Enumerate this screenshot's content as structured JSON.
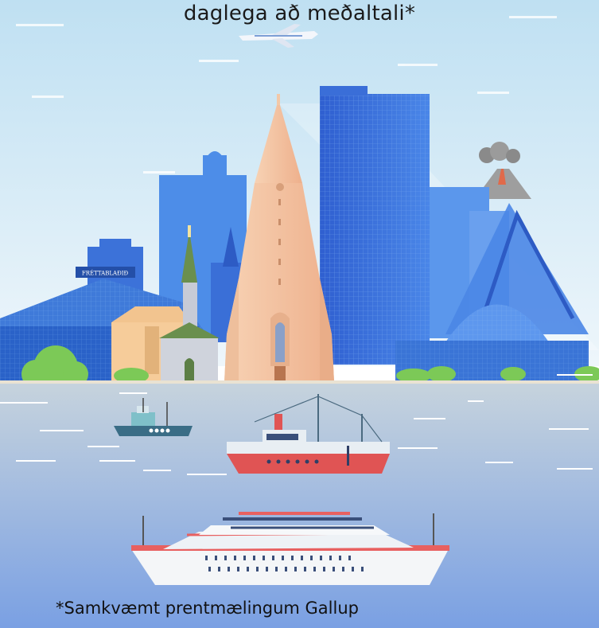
{
  "headline": "daglega að meðaltali*",
  "building_sign": "FRÉTTABLAÐIÐ",
  "footnote": "*Samkvæmt prentmælingum Gallup",
  "colors": {
    "sky_top": "#cfe6f3",
    "sky_bottom": "#eaf4fa",
    "sea_top": "#c3d2de",
    "sea_bottom": "#7fa3e0",
    "tower_blue": "#3b6fd6",
    "church_peach": "#f4c3a1",
    "ship_red": "#e45b5b"
  }
}
